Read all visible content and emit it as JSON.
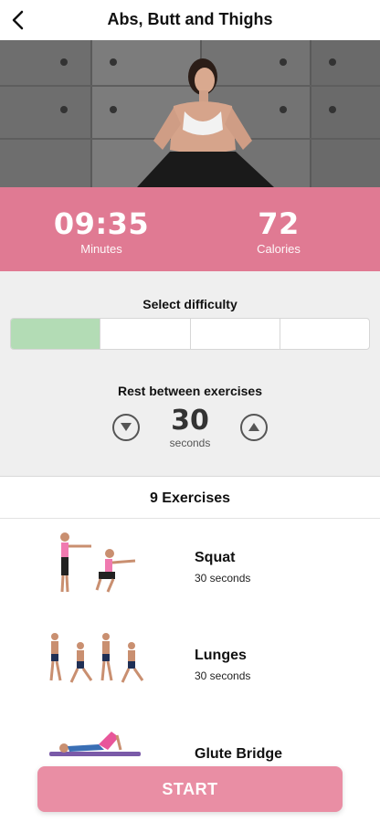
{
  "header": {
    "title": "Abs, Butt and Thighs",
    "back_icon": "chevron-left-icon"
  },
  "stats": {
    "duration": {
      "value": "09:35",
      "label": "Minutes"
    },
    "calories": {
      "value": "72",
      "label": "Calories"
    },
    "color": "#e07a93"
  },
  "difficulty": {
    "label": "Select difficulty",
    "levels": 4,
    "selected_level": 1,
    "active_color": "#b3dcb5"
  },
  "rest": {
    "label": "Rest between exercises",
    "value": "30",
    "unit": "seconds",
    "decrease_icon": "triangle-down-circle-icon",
    "increase_icon": "triangle-up-circle-icon"
  },
  "exercises": {
    "header": "9 Exercises",
    "items": [
      {
        "name": "Squat",
        "duration": "30 seconds"
      },
      {
        "name": "Lunges",
        "duration": "30 seconds"
      },
      {
        "name": "Glute Bridge",
        "duration": ""
      }
    ]
  },
  "start_button": {
    "label": "START",
    "color": "#e98ea4"
  }
}
